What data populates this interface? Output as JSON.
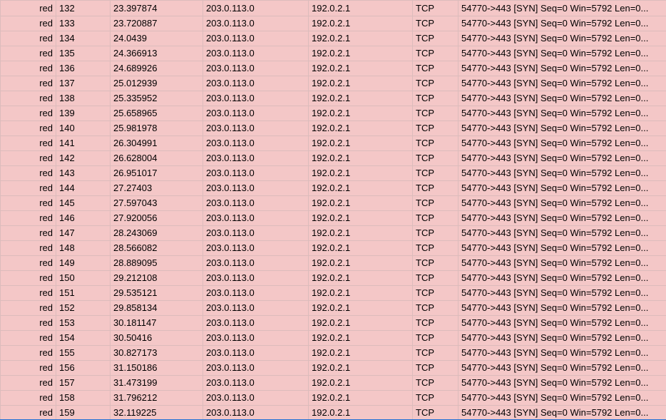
{
  "rows": [
    {
      "color": "red",
      "no": "132",
      "time": "23.397874",
      "source": "203.0.113.0",
      "destination": "192.0.2.1",
      "protocol": "TCP",
      "info": "54770->443 [SYN] Seq=0 Win=5792 Len=0..."
    },
    {
      "color": "red",
      "no": "133",
      "time": "23.720887",
      "source": "203.0.113.0",
      "destination": "192.0.2.1",
      "protocol": "TCP",
      "info": "54770->443 [SYN] Seq=0 Win=5792 Len=0..."
    },
    {
      "color": "red",
      "no": "134",
      "time": "24.0439",
      "source": "203.0.113.0",
      "destination": "192.0.2.1",
      "protocol": "TCP",
      "info": "54770->443 [SYN] Seq=0 Win=5792 Len=0..."
    },
    {
      "color": "red",
      "no": "135",
      "time": "24.366913",
      "source": "203.0.113.0",
      "destination": "192.0.2.1",
      "protocol": "TCP",
      "info": "54770->443 [SYN] Seq=0 Win=5792 Len=0..."
    },
    {
      "color": "red",
      "no": "136",
      "time": "24.689926",
      "source": "203.0.113.0",
      "destination": "192.0.2.1",
      "protocol": "TCP",
      "info": "54770->443 [SYN] Seq=0 Win=5792 Len=0..."
    },
    {
      "color": "red",
      "no": "137",
      "time": "25.012939",
      "source": "203.0.113.0",
      "destination": "192.0.2.1",
      "protocol": "TCP",
      "info": "54770->443 [SYN] Seq=0 Win=5792 Len=0..."
    },
    {
      "color": "red",
      "no": "138",
      "time": "25.335952",
      "source": "203.0.113.0",
      "destination": "192.0.2.1",
      "protocol": "TCP",
      "info": "54770->443 [SYN] Seq=0 Win=5792 Len=0..."
    },
    {
      "color": "red",
      "no": "139",
      "time": "25.658965",
      "source": "203.0.113.0",
      "destination": "192.0.2.1",
      "protocol": "TCP",
      "info": "54770->443 [SYN] Seq=0 Win=5792 Len=0..."
    },
    {
      "color": "red",
      "no": "140",
      "time": "25.981978",
      "source": "203.0.113.0",
      "destination": "192.0.2.1",
      "protocol": "TCP",
      "info": "54770->443 [SYN] Seq=0 Win=5792 Len=0..."
    },
    {
      "color": "red",
      "no": "141",
      "time": "26.304991",
      "source": "203.0.113.0",
      "destination": "192.0.2.1",
      "protocol": "TCP",
      "info": "54770->443 [SYN] Seq=0 Win=5792 Len=0..."
    },
    {
      "color": "red",
      "no": "142",
      "time": "26.628004",
      "source": "203.0.113.0",
      "destination": "192.0.2.1",
      "protocol": "TCP",
      "info": "54770->443 [SYN] Seq=0 Win=5792 Len=0..."
    },
    {
      "color": "red",
      "no": "143",
      "time": "26.951017",
      "source": "203.0.113.0",
      "destination": "192.0.2.1",
      "protocol": "TCP",
      "info": "54770->443 [SYN] Seq=0 Win=5792 Len=0..."
    },
    {
      "color": "red",
      "no": "144",
      "time": "27.27403",
      "source": "203.0.113.0",
      "destination": "192.0.2.1",
      "protocol": "TCP",
      "info": "54770->443 [SYN] Seq=0 Win=5792 Len=0..."
    },
    {
      "color": "red",
      "no": "145",
      "time": "27.597043",
      "source": "203.0.113.0",
      "destination": "192.0.2.1",
      "protocol": "TCP",
      "info": "54770->443 [SYN] Seq=0 Win=5792 Len=0..."
    },
    {
      "color": "red",
      "no": "146",
      "time": "27.920056",
      "source": "203.0.113.0",
      "destination": "192.0.2.1",
      "protocol": "TCP",
      "info": "54770->443 [SYN] Seq=0 Win=5792 Len=0..."
    },
    {
      "color": "red",
      "no": "147",
      "time": "28.243069",
      "source": "203.0.113.0",
      "destination": "192.0.2.1",
      "protocol": "TCP",
      "info": "54770->443 [SYN] Seq=0 Win=5792 Len=0..."
    },
    {
      "color": "red",
      "no": "148",
      "time": "28.566082",
      "source": "203.0.113.0",
      "destination": "192.0.2.1",
      "protocol": "TCP",
      "info": "54770->443 [SYN] Seq=0 Win=5792 Len=0..."
    },
    {
      "color": "red",
      "no": "149",
      "time": "28.889095",
      "source": "203.0.113.0",
      "destination": "192.0.2.1",
      "protocol": "TCP",
      "info": "54770->443 [SYN] Seq=0 Win=5792 Len=0..."
    },
    {
      "color": "red",
      "no": "150",
      "time": "29.212108",
      "source": "203.0.113.0",
      "destination": "192.0.2.1",
      "protocol": "TCP",
      "info": "54770->443 [SYN] Seq=0 Win=5792 Len=0..."
    },
    {
      "color": "red",
      "no": "151",
      "time": "29.535121",
      "source": "203.0.113.0",
      "destination": "192.0.2.1",
      "protocol": "TCP",
      "info": "54770->443 [SYN] Seq=0 Win=5792 Len=0..."
    },
    {
      "color": "red",
      "no": "152",
      "time": "29.858134",
      "source": "203.0.113.0",
      "destination": "192.0.2.1",
      "protocol": "TCP",
      "info": "54770->443 [SYN] Seq=0 Win=5792 Len=0..."
    },
    {
      "color": "red",
      "no": "153",
      "time": "30.181147",
      "source": "203.0.113.0",
      "destination": "192.0.2.1",
      "protocol": "TCP",
      "info": "54770->443 [SYN] Seq=0 Win=5792 Len=0..."
    },
    {
      "color": "red",
      "no": "154",
      "time": "30.50416",
      "source": "203.0.113.0",
      "destination": "192.0.2.1",
      "protocol": "TCP",
      "info": "54770->443 [SYN] Seq=0 Win=5792 Len=0..."
    },
    {
      "color": "red",
      "no": "155",
      "time": "30.827173",
      "source": "203.0.113.0",
      "destination": "192.0.2.1",
      "protocol": "TCP",
      "info": "54770->443 [SYN] Seq=0 Win=5792 Len=0..."
    },
    {
      "color": "red",
      "no": "156",
      "time": "31.150186",
      "source": "203.0.113.0",
      "destination": "192.0.2.1",
      "protocol": "TCP",
      "info": "54770->443 [SYN] Seq=0 Win=5792 Len=0..."
    },
    {
      "color": "red",
      "no": "157",
      "time": "31.473199",
      "source": "203.0.113.0",
      "destination": "192.0.2.1",
      "protocol": "TCP",
      "info": "54770->443 [SYN] Seq=0 Win=5792 Len=0..."
    },
    {
      "color": "red",
      "no": "158",
      "time": "31.796212",
      "source": "203.0.113.0",
      "destination": "192.0.2.1",
      "protocol": "TCP",
      "info": "54770->443 [SYN] Seq=0 Win=5792 Len=0..."
    },
    {
      "color": "red",
      "no": "159",
      "time": "32.119225",
      "source": "203.0.113.0",
      "destination": "192.0.2.1",
      "protocol": "TCP",
      "info": "54770->443 [SYN] Seq=0 Win=5792 Len=0..."
    }
  ],
  "colors": {
    "row_fill": "#f4c7c7",
    "gridline": "#dcbcbc",
    "selection_edge": "#1f6fd6"
  }
}
